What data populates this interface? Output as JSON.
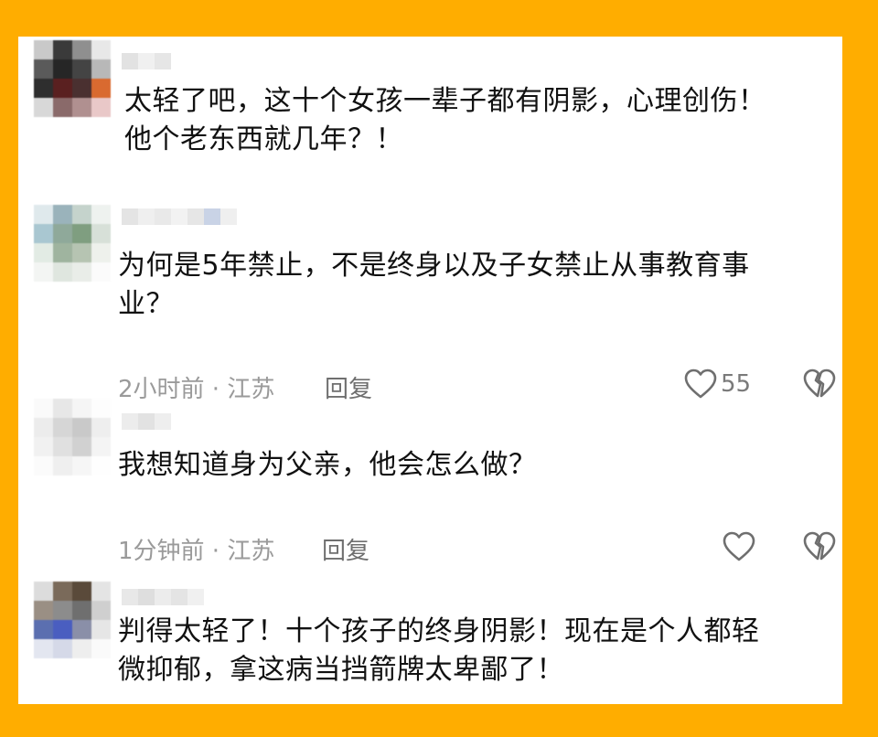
{
  "colors": {
    "frame": "#ffad00",
    "card": "#ffffff",
    "text": "#111111",
    "meta": "#9a9a9a",
    "action": "#6f6f6f"
  },
  "comments": [
    {
      "text_lines": [
        "太轻了吧，这十个女孩一辈子都有阴影，心理创伤！",
        "他个老东西就几年？！"
      ]
    },
    {
      "text_lines": [
        "为何是5年禁止，不是终身以及子女禁止从事教育事",
        "业？"
      ],
      "time_location": "2小时前 · 江苏",
      "reply_label": "回复",
      "like_count": "55",
      "like_icon": "heart-outline-icon",
      "dislike_icon": "broken-heart-icon"
    },
    {
      "text_lines": [
        "我想知道身为父亲，他会怎么做？"
      ],
      "time_location": "1分钟前 · 江苏",
      "reply_label": "回复",
      "like_icon": "heart-outline-icon",
      "dislike_icon": "broken-heart-icon"
    },
    {
      "text_lines": [
        "判得太轻了！十个孩子的终身阴影！现在是个人都轻",
        "微抑郁，拿这病当挡箭牌太卑鄙了！"
      ]
    }
  ]
}
